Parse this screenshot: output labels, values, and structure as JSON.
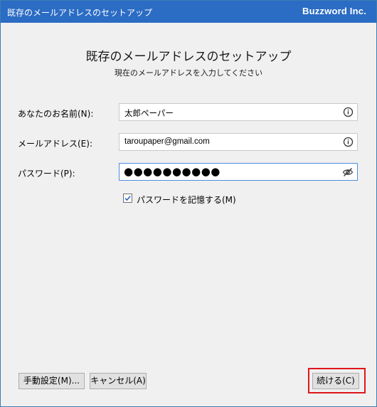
{
  "window": {
    "title": "既存のメールアドレスのセットアップ",
    "brand": "Buzzword Inc."
  },
  "dialog": {
    "heading": "既存のメールアドレスのセットアップ",
    "subheading": "現在のメールアドレスを入力してください"
  },
  "form": {
    "name_label": "あなたのお名前(N):",
    "name_value": "太郎ペーパー",
    "email_label": "メールアドレス(E):",
    "email_value": "taroupaper@gmail.com",
    "password_label": "パスワード(P):",
    "password_masked": "●●●●●●●●●●",
    "remember_label": "パスワードを記憶する(M)",
    "remember_checked": true
  },
  "buttons": {
    "manual_config": "手動設定(M)...",
    "cancel": "キャンセル(A)",
    "continue": "続ける(C)"
  },
  "icons": {
    "name_info": "info-icon",
    "email_info": "info-icon",
    "password_visibility": "eye-slash-icon",
    "remember_check": "checkmark-icon"
  },
  "colors": {
    "titlebar": "#2b6cc4",
    "focus_border": "#4a8fe0",
    "highlight": "#e0161b"
  }
}
